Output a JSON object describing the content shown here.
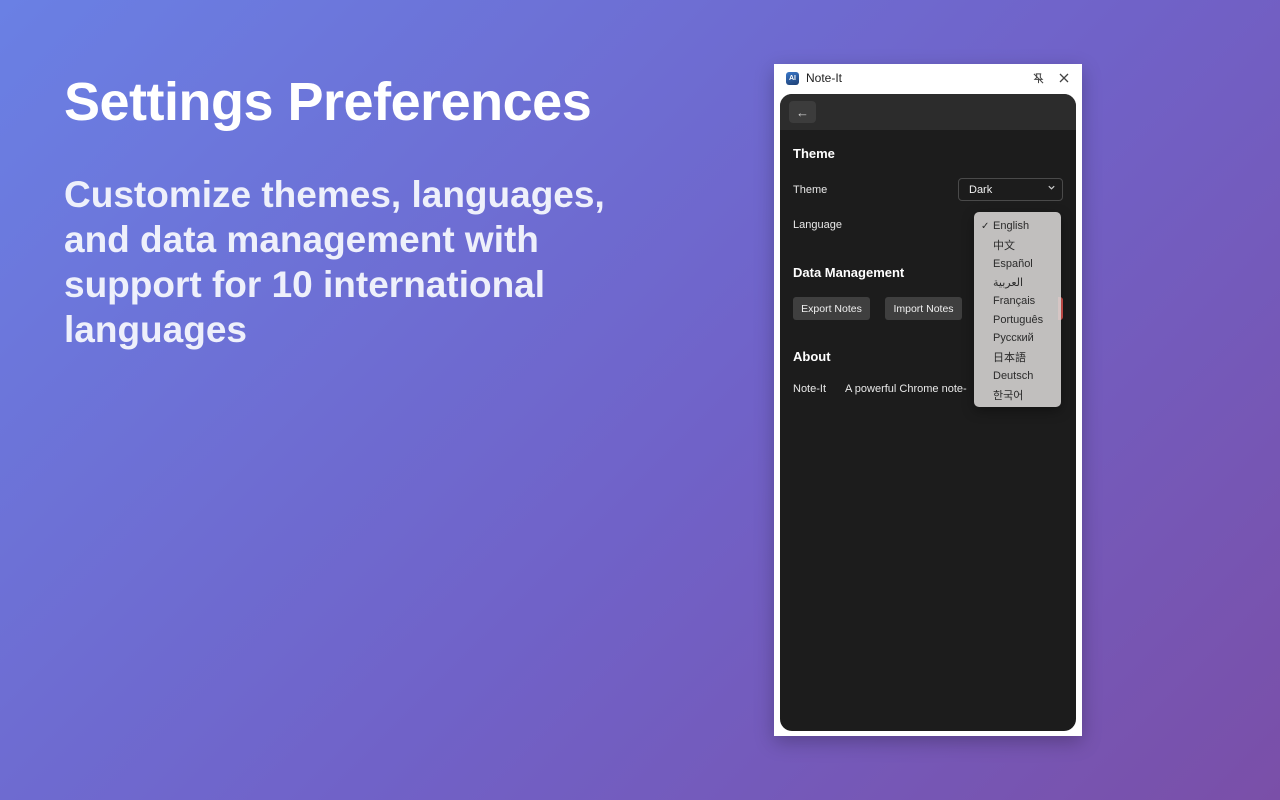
{
  "hero": {
    "title": "Settings Preferences",
    "subtitle": "Customize themes, languages, and data management with support for 10 international languages"
  },
  "window": {
    "title": "Note-It",
    "icon_text": "AI",
    "pin_icon": "pin-icon",
    "close_icon": "close-icon"
  },
  "settings": {
    "back_icon": "←",
    "theme_section": "Theme",
    "theme_label": "Theme",
    "theme_value": "Dark",
    "language_label": "Language",
    "data_section": "Data Management",
    "export_label": "Export Notes",
    "import_label": "Import Notes",
    "about_section": "About",
    "about_name": "Note-It",
    "about_desc": "A powerful Chrome note-"
  },
  "language_dropdown": {
    "selected": "English",
    "options": [
      "English",
      "中文",
      "Español",
      "العربية",
      "Français",
      "Português",
      "Русский",
      "日本語",
      "Deutsch",
      "한국어"
    ]
  },
  "colors": {
    "accent_red": "#d9534f",
    "panel_bg": "#1c1c1c"
  }
}
